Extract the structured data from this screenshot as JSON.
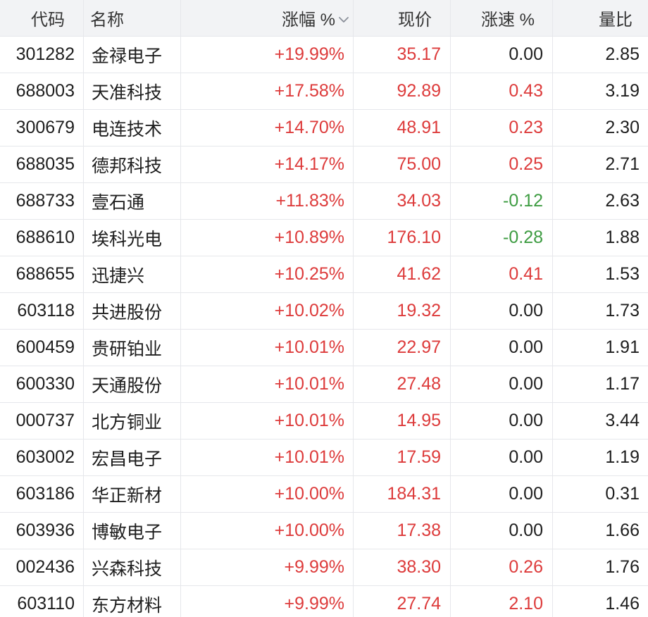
{
  "colors": {
    "up": "#dd3b3b",
    "down": "#3e9c42",
    "flat": "#1e1e1e"
  },
  "header": {
    "code": "代码",
    "name": "名称",
    "change_pct": "涨幅 %",
    "change_pct_sort_icon": "chevron-down-icon",
    "price": "现价",
    "speed_pct": "涨速 %",
    "volume_ratio": "量比"
  },
  "rows": [
    {
      "code": "301282",
      "name": "金禄电子",
      "change_pct": "+19.99%",
      "price": "35.17",
      "speed_pct": "0.00",
      "volume_ratio": "2.85"
    },
    {
      "code": "688003",
      "name": "天准科技",
      "change_pct": "+17.58%",
      "price": "92.89",
      "speed_pct": "0.43",
      "volume_ratio": "3.19"
    },
    {
      "code": "300679",
      "name": "电连技术",
      "change_pct": "+14.70%",
      "price": "48.91",
      "speed_pct": "0.23",
      "volume_ratio": "2.30"
    },
    {
      "code": "688035",
      "name": "德邦科技",
      "change_pct": "+14.17%",
      "price": "75.00",
      "speed_pct": "0.25",
      "volume_ratio": "2.71"
    },
    {
      "code": "688733",
      "name": "壹石通",
      "change_pct": "+11.83%",
      "price": "34.03",
      "speed_pct": "-0.12",
      "volume_ratio": "2.63"
    },
    {
      "code": "688610",
      "name": "埃科光电",
      "change_pct": "+10.89%",
      "price": "176.10",
      "speed_pct": "-0.28",
      "volume_ratio": "1.88"
    },
    {
      "code": "688655",
      "name": "迅捷兴",
      "change_pct": "+10.25%",
      "price": "41.62",
      "speed_pct": "0.41",
      "volume_ratio": "1.53"
    },
    {
      "code": "603118",
      "name": "共进股份",
      "change_pct": "+10.02%",
      "price": "19.32",
      "speed_pct": "0.00",
      "volume_ratio": "1.73"
    },
    {
      "code": "600459",
      "name": "贵研铂业",
      "change_pct": "+10.01%",
      "price": "22.97",
      "speed_pct": "0.00",
      "volume_ratio": "1.91"
    },
    {
      "code": "600330",
      "name": "天通股份",
      "change_pct": "+10.01%",
      "price": "27.48",
      "speed_pct": "0.00",
      "volume_ratio": "1.17"
    },
    {
      "code": "000737",
      "name": "北方铜业",
      "change_pct": "+10.01%",
      "price": "14.95",
      "speed_pct": "0.00",
      "volume_ratio": "3.44"
    },
    {
      "code": "603002",
      "name": "宏昌电子",
      "change_pct": "+10.01%",
      "price": "17.59",
      "speed_pct": "0.00",
      "volume_ratio": "1.19"
    },
    {
      "code": "603186",
      "name": "华正新材",
      "change_pct": "+10.00%",
      "price": "184.31",
      "speed_pct": "0.00",
      "volume_ratio": "0.31"
    },
    {
      "code": "603936",
      "name": "博敏电子",
      "change_pct": "+10.00%",
      "price": "17.38",
      "speed_pct": "0.00",
      "volume_ratio": "1.66"
    },
    {
      "code": "002436",
      "name": "兴森科技",
      "change_pct": "+9.99%",
      "price": "38.30",
      "speed_pct": "0.26",
      "volume_ratio": "1.76"
    },
    {
      "code": "603110",
      "name": "东方材料",
      "change_pct": "+9.99%",
      "price": "27.74",
      "speed_pct": "2.10",
      "volume_ratio": "1.46"
    }
  ]
}
